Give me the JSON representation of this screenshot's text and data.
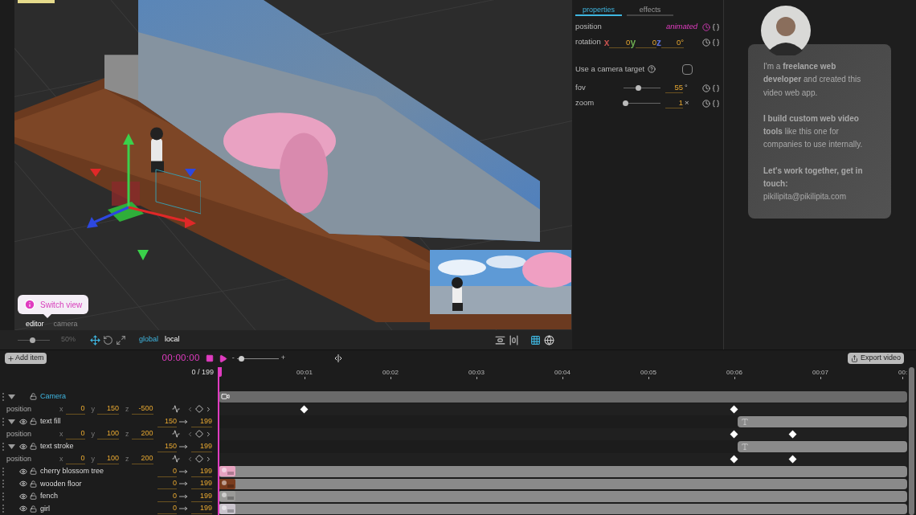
{
  "viewport": {
    "hint": "Switch view",
    "views": [
      {
        "label": "editor",
        "selected": true
      },
      {
        "label": "camera",
        "selected": false
      }
    ],
    "zoom": {
      "level": 0.45,
      "reading": "50%"
    },
    "transform_modes": [
      {
        "kind": "move",
        "selected": true
      },
      {
        "kind": "rotate",
        "selected": false
      },
      {
        "kind": "scale",
        "selected": false
      }
    ],
    "spaces": [
      {
        "label": "global",
        "selected": true
      },
      {
        "label": "local",
        "selected": false
      }
    ],
    "grid_on": true
  },
  "properties": {
    "tabs": [
      {
        "label": "properties",
        "selected": true
      },
      {
        "label": "effects",
        "selected": false
      }
    ],
    "position": {
      "label": "position",
      "status": "animated",
      "animated": true
    },
    "rotation": {
      "label": "rotation",
      "animated": false,
      "unit": "°",
      "axes": [
        {
          "axis": "x",
          "value": "0",
          "color": "#c0504d"
        },
        {
          "axis": "y",
          "value": "0",
          "color": "#6aa84f"
        },
        {
          "axis": "z",
          "value": "0",
          "color": "#5b6fd6"
        }
      ]
    },
    "camera_target": {
      "label": "Use a camera target",
      "checked": false
    },
    "sliders": [
      {
        "label": "fov",
        "level": 0.4,
        "value": "55",
        "unit": "°",
        "animated": false
      },
      {
        "label": "zoom",
        "level": 0.05,
        "value": "1",
        "unit": "×",
        "animated": false
      }
    ]
  },
  "about": {
    "paragraphs": [
      "I'm a **freelance web developer** and created this video web app.",
      "**I build custom web video tools** like this one for companies to use internally.",
      "**Let's work together, get in touch:**"
    ],
    "email": "pikilipita@pikilipita.com"
  },
  "timeline": {
    "add_label": "Add item",
    "timecode": "00:00:00",
    "frame": "0",
    "separator": "/",
    "total": "199",
    "scale": {
      "level": 0.1,
      "minus": "-",
      "plus": "+"
    },
    "export_label": "Export video",
    "ruler": [
      "00:01",
      "00:02",
      "00:03",
      "00:04",
      "00:05",
      "00:06",
      "00:07",
      "00:"
    ],
    "playhead": {
      "level": 0
    }
  },
  "tracks": [
    {
      "kind": "camera",
      "name": "Camera",
      "selected": true,
      "expanded": true,
      "properties": [
        {
          "name": "position",
          "coords": [
            {
              "axis": "x",
              "value": "0"
            },
            {
              "axis": "y",
              "value": "150"
            },
            {
              "axis": "z",
              "value": "-500"
            }
          ],
          "keyframes": [
            {
              "level": 0.124
            },
            {
              "level": 0.749
            }
          ]
        }
      ]
    },
    {
      "kind": "text",
      "name": "text fill",
      "selected": false,
      "expanded": true,
      "start": "150",
      "end": "199",
      "properties": [
        {
          "name": "position",
          "coords": [
            {
              "axis": "x",
              "value": "0"
            },
            {
              "axis": "y",
              "value": "100"
            },
            {
              "axis": "z",
              "value": "200"
            }
          ],
          "keyframes": [
            {
              "level": 0.749
            },
            {
              "level": 0.834
            }
          ]
        }
      ]
    },
    {
      "kind": "text",
      "name": "text stroke",
      "selected": false,
      "expanded": true,
      "start": "150",
      "end": "199",
      "properties": [
        {
          "name": "position",
          "coords": [
            {
              "axis": "x",
              "value": "0"
            },
            {
              "axis": "y",
              "value": "100"
            },
            {
              "axis": "z",
              "value": "200"
            }
          ],
          "keyframes": [
            {
              "level": 0.749
            },
            {
              "level": 0.834
            }
          ]
        }
      ]
    },
    {
      "name": "cherry blossom tree",
      "selected": false,
      "start": "0",
      "end": "199",
      "color": "#e7a3c0"
    },
    {
      "name": "wooden floor",
      "selected": false,
      "start": "0",
      "end": "199",
      "color": "#7a3c1e"
    },
    {
      "name": "fench",
      "selected": false,
      "start": "0",
      "end": "199",
      "color": "#9a9a98"
    },
    {
      "name": "girl",
      "selected": false,
      "start": "0",
      "end": "199",
      "color": "#c9c4cc"
    }
  ]
}
